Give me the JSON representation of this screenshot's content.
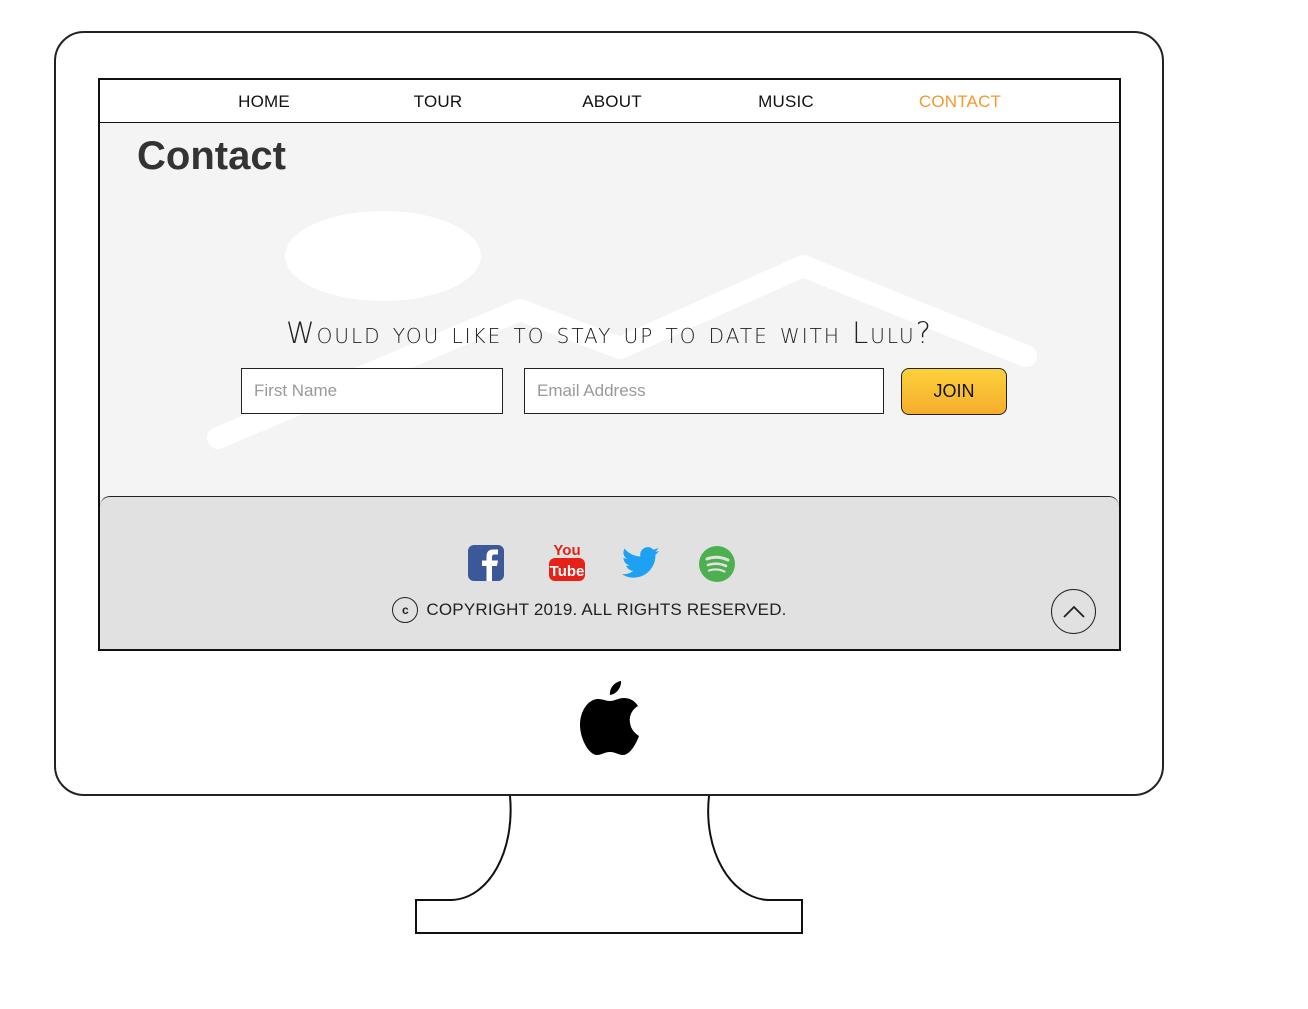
{
  "nav": {
    "items": [
      {
        "label": "HOME"
      },
      {
        "label": "TOUR"
      },
      {
        "label": "ABOUT"
      },
      {
        "label": "MUSIC"
      },
      {
        "label": "CONTACT",
        "active": true
      }
    ]
  },
  "page": {
    "title": "Contact"
  },
  "signup": {
    "tagline": "Would you like to stay up to date with Lulu?",
    "first_name_placeholder": "First Name",
    "email_placeholder": "Email Address",
    "join_label": "JOIN"
  },
  "footer": {
    "social_icons": [
      "facebook-icon",
      "youtube-icon",
      "twitter-icon",
      "spotify-icon"
    ],
    "youtube_you": "You",
    "youtube_tube": "Tube",
    "copyright_symbol": "c",
    "copyright": "COPYRIGHT 2019. ALL RIGHTS RESERVED."
  },
  "colors": {
    "accent": "#f29a2e",
    "join_top": "#fbd13b",
    "join_bottom": "#f6ae2d",
    "facebook": "#3b5998",
    "youtube": "#e62117",
    "twitter": "#1da1f2",
    "spotify": "#4caf50",
    "content_bg": "#f4f4f4",
    "footer_bg": "#e1e1e1"
  }
}
